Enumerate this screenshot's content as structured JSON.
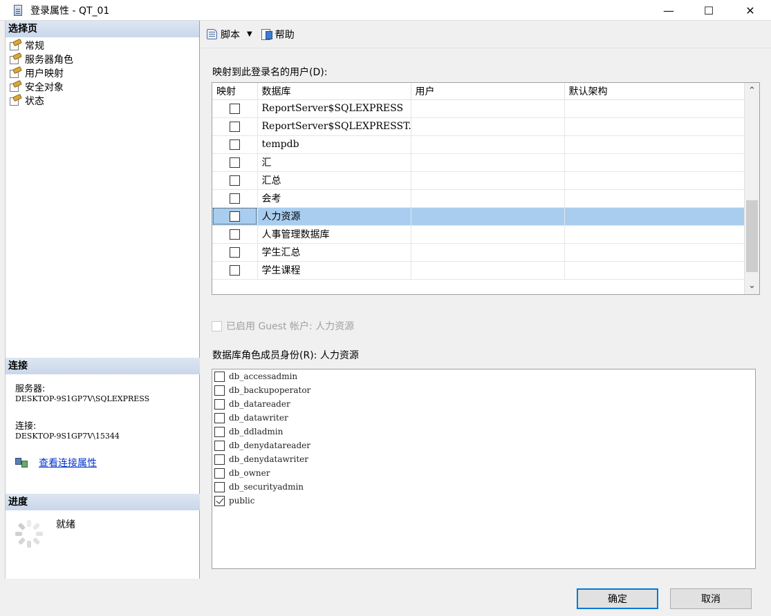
{
  "window": {
    "title": "登录属性 - QT_01",
    "minimize": "—",
    "maximize": "☐",
    "close": "✕"
  },
  "left": {
    "select_page_heading": "选择页",
    "pages": [
      {
        "label": "常规",
        "icon": "page-wrench-icon"
      },
      {
        "label": "服务器角色",
        "icon": "page-wrench-icon"
      },
      {
        "label": "用户映射",
        "icon": "page-wrench-icon"
      },
      {
        "label": "安全对象",
        "icon": "page-wrench-icon"
      },
      {
        "label": "状态",
        "icon": "page-wrench-icon"
      }
    ],
    "connection_heading": "连接",
    "server_label": "服务器:",
    "server_value": "DESKTOP-9S1GP7V\\SQLEXPRESS",
    "connection_label": "连接:",
    "connection_value": "DESKTOP-9S1GP7V\\15344",
    "view_connection_link": "查看连接属性",
    "progress_heading": "进度",
    "progress_status": "就绪"
  },
  "toolbar": {
    "script_label": "脚本",
    "help_label": "帮助"
  },
  "mapping": {
    "label": "映射到此登录名的用户(D):",
    "columns": [
      "映射",
      "数据库",
      "用户",
      "默认架构"
    ],
    "rows": [
      {
        "mapped": false,
        "database": "ReportServer$SQLEXPRESS",
        "user": "",
        "schema": "",
        "mono": true
      },
      {
        "mapped": false,
        "database": "ReportServer$SQLEXPRESST...",
        "user": "",
        "schema": "",
        "mono": true
      },
      {
        "mapped": false,
        "database": "tempdb",
        "user": "",
        "schema": "",
        "mono": true
      },
      {
        "mapped": false,
        "database": "汇",
        "user": "",
        "schema": "",
        "mono": false
      },
      {
        "mapped": false,
        "database": "汇总",
        "user": "",
        "schema": "",
        "mono": false
      },
      {
        "mapped": false,
        "database": "会考",
        "user": "",
        "schema": "",
        "mono": false
      },
      {
        "mapped": false,
        "database": "人力资源",
        "user": "",
        "schema": "",
        "mono": false,
        "selected": true
      },
      {
        "mapped": false,
        "database": "人事管理数据库",
        "user": "",
        "schema": "",
        "mono": false
      },
      {
        "mapped": false,
        "database": "学生汇总",
        "user": "",
        "schema": "",
        "mono": false
      },
      {
        "mapped": false,
        "database": "学生课程",
        "user": "",
        "schema": "",
        "mono": false
      }
    ]
  },
  "guest": {
    "label": "已启用 Guest 帐户: 人力资源",
    "enabled": false
  },
  "roles": {
    "label": "数据库角色成员身份(R): 人力资源",
    "items": [
      {
        "name": "db_accessadmin",
        "checked": false
      },
      {
        "name": "db_backupoperator",
        "checked": false
      },
      {
        "name": "db_datareader",
        "checked": false
      },
      {
        "name": "db_datawriter",
        "checked": false
      },
      {
        "name": "db_ddladmin",
        "checked": false
      },
      {
        "name": "db_denydatareader",
        "checked": false
      },
      {
        "name": "db_denydatawriter",
        "checked": false
      },
      {
        "name": "db_owner",
        "checked": false
      },
      {
        "name": "db_securityadmin",
        "checked": false
      },
      {
        "name": "public",
        "checked": true
      }
    ]
  },
  "buttons": {
    "ok": "确定",
    "cancel": "取消"
  }
}
